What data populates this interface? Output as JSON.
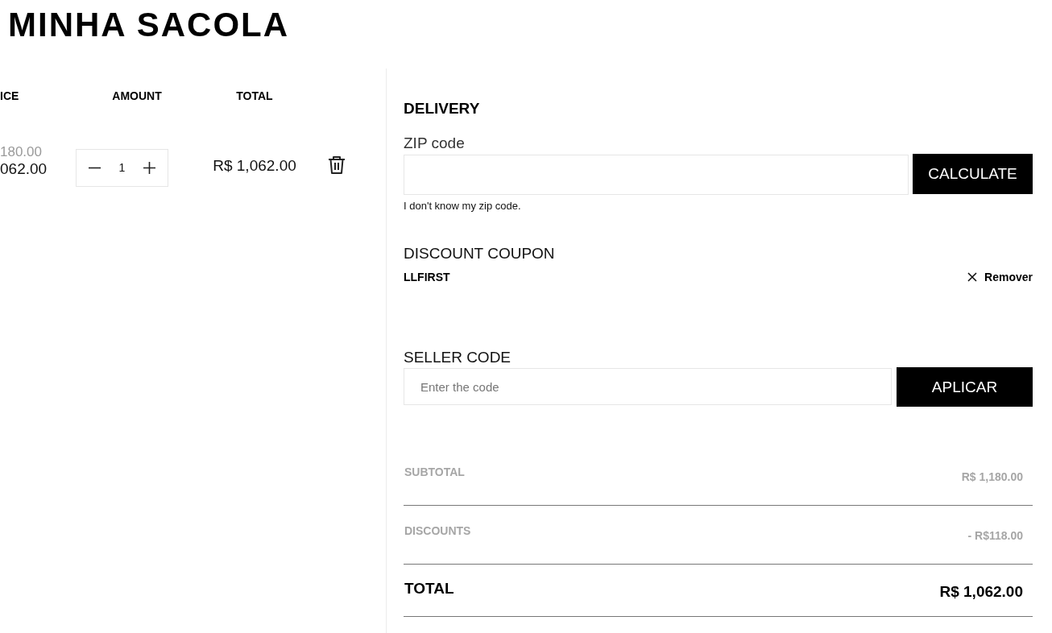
{
  "page_title": "MINHA SACOLA",
  "cart": {
    "columns": [
      "ICE",
      "AMOUNT",
      "TOTAL"
    ],
    "items": [
      {
        "original_price": "180.00",
        "price": "062.00",
        "quantity": "1",
        "total": "R$ 1,062.00"
      }
    ]
  },
  "delivery": {
    "title": "DELIVERY",
    "zip_label": "ZIP code",
    "calculate_button": "CALCULATE",
    "help_link": "I don't know my zip code."
  },
  "coupon": {
    "title": "DISCOUNT COUPON",
    "code": "LLFIRST",
    "remove_button": "Remover"
  },
  "seller_code": {
    "title": "SELLER CODE",
    "placeholder": "Enter the code",
    "apply_button": "APLICAR"
  },
  "summary": [
    {
      "kind": "minor",
      "label": "SUBTOTAL",
      "value": "R$ 1,180.00"
    },
    {
      "kind": "minor",
      "label": "DISCOUNTS",
      "value": "- R$118.00"
    },
    {
      "kind": "total",
      "label": "TOTAL",
      "value": "R$ 1,062.00"
    }
  ]
}
